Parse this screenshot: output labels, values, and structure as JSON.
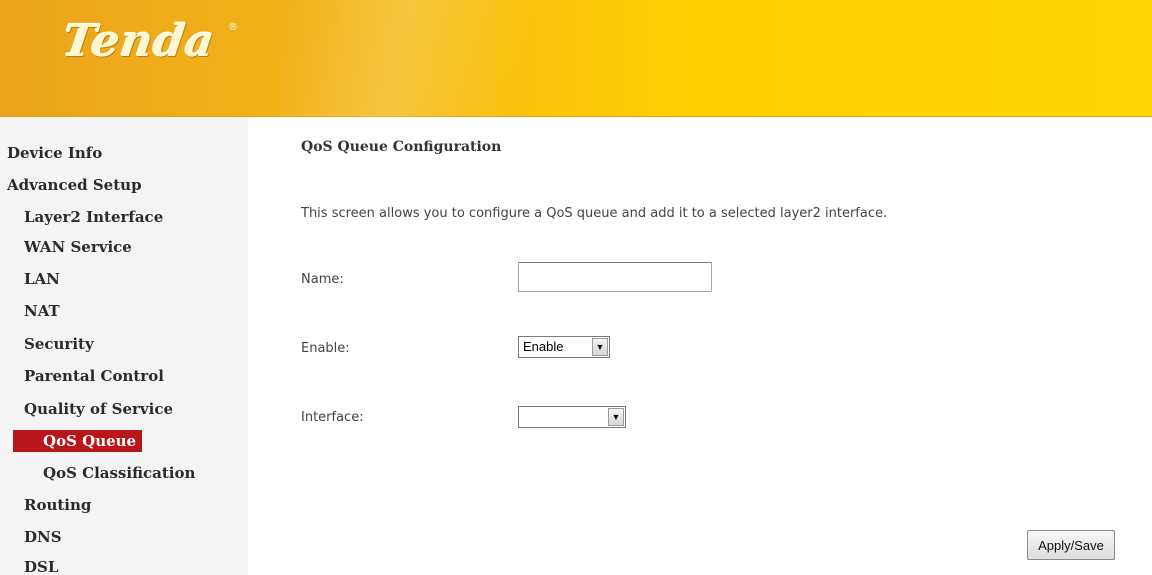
{
  "brand": {
    "logo_text": "Tenda",
    "registered_mark": "®"
  },
  "sidebar": {
    "items": [
      {
        "label": "Device Info"
      },
      {
        "label": "Advanced Setup"
      },
      {
        "label": "Layer2 Interface"
      },
      {
        "label": "WAN Service"
      },
      {
        "label": "LAN"
      },
      {
        "label": "NAT"
      },
      {
        "label": "Security"
      },
      {
        "label": "Parental Control"
      },
      {
        "label": "Quality of Service"
      },
      {
        "label": "QoS Queue",
        "active": true
      },
      {
        "label": "QoS Classification"
      },
      {
        "label": "Routing"
      },
      {
        "label": "DNS"
      },
      {
        "label": "DSL"
      }
    ]
  },
  "main": {
    "title": "QoS Queue Configuration",
    "description": "This screen allows you to configure a QoS queue and add it to a selected layer2 interface.",
    "fields": {
      "name": {
        "label": "Name:",
        "value": ""
      },
      "enable": {
        "label": "Enable:",
        "value": "Enable"
      },
      "interface": {
        "label": "Interface:",
        "value": ""
      }
    },
    "apply_label": "Apply/Save"
  },
  "colors": {
    "header_left": "#e9a41b",
    "header_right": "#ffd400",
    "active_nav": "#b8161b"
  }
}
